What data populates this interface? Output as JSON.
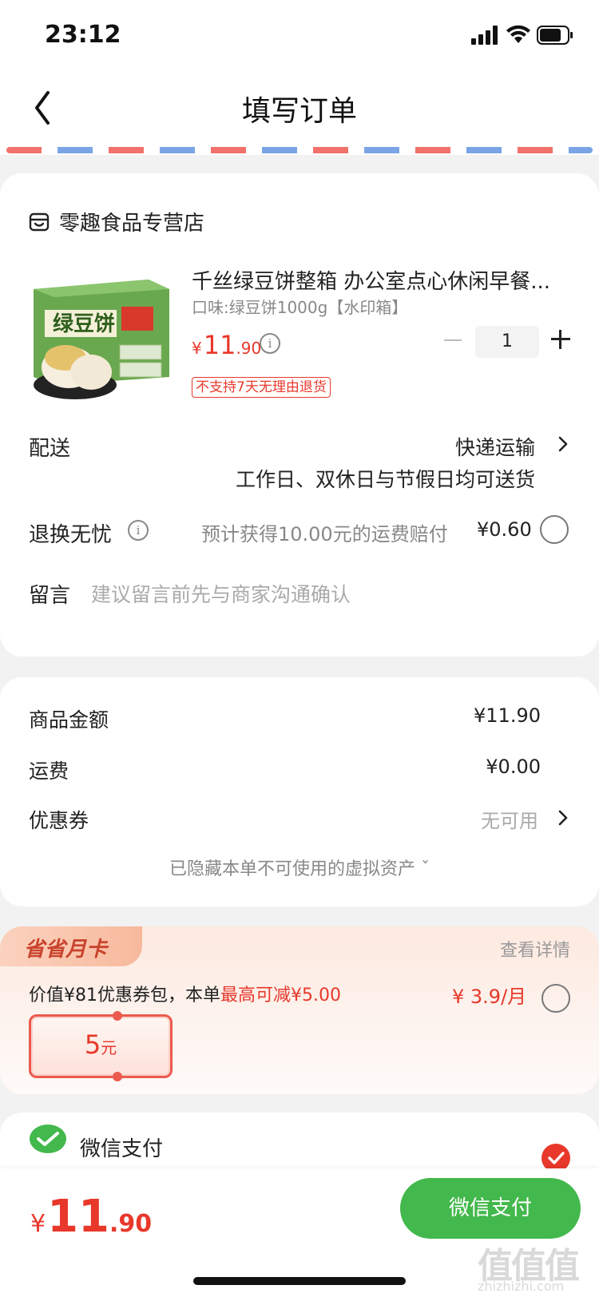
{
  "status_bar": {
    "time": "23:12"
  },
  "nav": {
    "title": "填写订单"
  },
  "shop": {
    "name": "零趣食品专营店"
  },
  "product": {
    "title": "千丝绿豆饼整箱 办公室点心休闲早餐...",
    "spec": "口味:绿豆饼1000g【水印箱】",
    "price_symbol": "¥",
    "price_int": "11",
    "price_dec": ".90",
    "quantity": "1",
    "return_tag": "不支持7天无理由退货"
  },
  "delivery": {
    "label": "配送",
    "method": "快递运输",
    "note": "工作日、双休日与节假日均可送货"
  },
  "return_worry_free": {
    "label": "退换无忧",
    "hint": "预计获得10.00元的运费赔付",
    "price": "¥0.60"
  },
  "message": {
    "label": "留言",
    "placeholder": "建议留言前先与商家沟通确认"
  },
  "summary": {
    "goods_label": "商品金额",
    "goods_value": "¥11.90",
    "shipping_label": "运费",
    "shipping_value": "¥0.00",
    "coupon_label": "优惠券",
    "coupon_value": "无可用",
    "hidden_assets": "已隐藏本单不可使用的虚拟资产 ˇ"
  },
  "monthly_card": {
    "title": "省省月卡",
    "detail_link": "查看详情",
    "desc_prefix": "价值¥81优惠券包，本单",
    "desc_highlight": "最高可减¥5.00",
    "price": "¥ 3.9/月",
    "voucher_amount": "5",
    "voucher_unit": "元"
  },
  "payment": {
    "method": "微信支付"
  },
  "bottom_bar": {
    "total_symbol": "¥",
    "total_int": "11",
    "total_dec": ".90",
    "pay_button": "微信支付"
  },
  "watermark": {
    "main": "值值值",
    "sub": "zhizhizhi.com"
  },
  "colors": {
    "accent_red": "#e8382b",
    "wechat_green": "#43b84c"
  }
}
